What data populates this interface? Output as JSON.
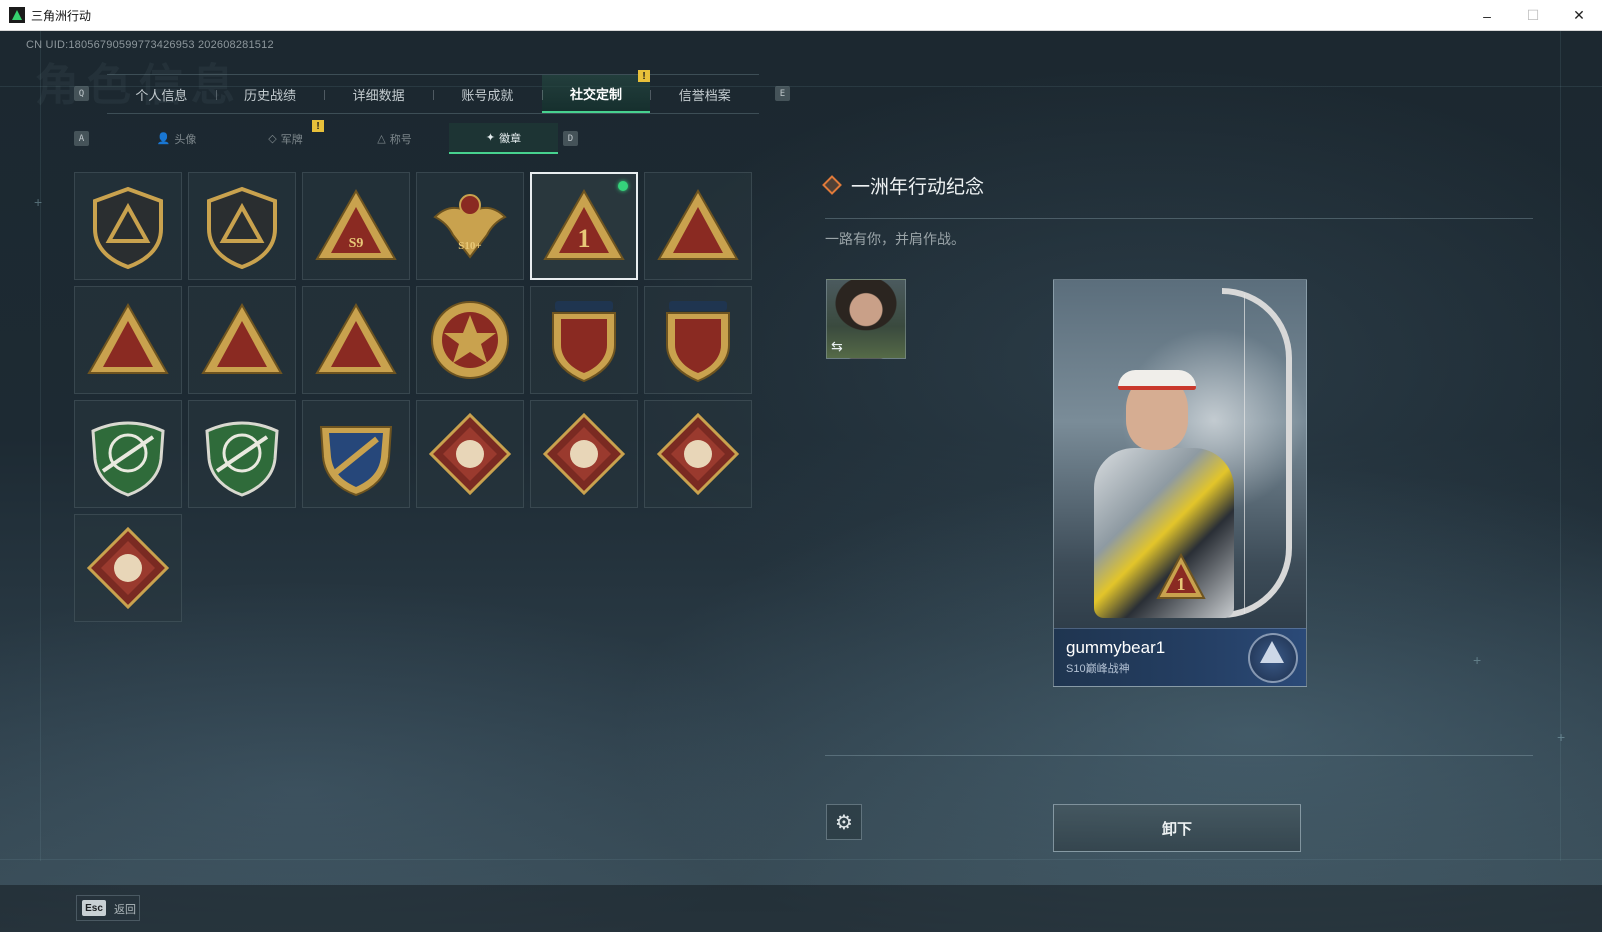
{
  "window": {
    "title": "三角洲行动",
    "controls": [
      "–",
      "☐",
      "✕"
    ]
  },
  "watermark": "角色信息",
  "uid": "CN UID:18056790599773426953 202608281512",
  "top_tabs": {
    "left_key": "Q",
    "right_key": "E",
    "items": [
      "个人信息",
      "历史战绩",
      "详细数据",
      "账号成就",
      "社交定制",
      "信誉档案"
    ],
    "active": "社交定制",
    "badge": "!"
  },
  "sub_tabs": {
    "left_key": "A",
    "right_key": "D",
    "items": [
      {
        "label": "头像",
        "icon": "person-icon"
      },
      {
        "label": "军牌",
        "icon": "dogtag-icon"
      },
      {
        "label": "称号",
        "icon": "title-icon"
      },
      {
        "label": "徽章",
        "icon": "badge-icon"
      }
    ],
    "active": "徽章",
    "badge": "!"
  },
  "medals": [
    {
      "name": "shield-delta-medal",
      "style": "shield"
    },
    {
      "name": "helicopter-medal",
      "style": "shield"
    },
    {
      "name": "s9-triangle-medal",
      "style": "triangle",
      "label": "S9"
    },
    {
      "name": "s10-eagle-medal",
      "style": "eagle",
      "label": "S10+"
    },
    {
      "name": "first-year-medal",
      "style": "triangle",
      "label": "1",
      "selected": true,
      "equipped": true
    },
    {
      "name": "hexagram-triangle-medal",
      "style": "triangle"
    },
    {
      "name": "squad-triangle-medal",
      "style": "triangle"
    },
    {
      "name": "squad-battle-triangle-medal",
      "style": "triangle"
    },
    {
      "name": "koi-triangle-medal",
      "style": "triangle"
    },
    {
      "name": "star-round-medal",
      "style": "round"
    },
    {
      "name": "three-star-shield-medal",
      "style": "crest"
    },
    {
      "name": "three-star-hexagram-medal",
      "style": "crest"
    },
    {
      "name": "green-rifle-shield-medal",
      "style": "green-shield"
    },
    {
      "name": "green-crossed-rifle-medal",
      "style": "green-shield"
    },
    {
      "name": "blue-gold-shield-medal",
      "style": "blue-shield"
    },
    {
      "name": "wolf-diamond-medal",
      "style": "diamond"
    },
    {
      "name": "tiger-diamond-medal",
      "style": "diamond"
    },
    {
      "name": "dragon-diamond-medal",
      "style": "diamond"
    },
    {
      "name": "wrench-diamond-medal",
      "style": "diamond"
    }
  ],
  "selected_medal": {
    "title": "一洲年行动纪念",
    "description": "一路有你，并肩作战。"
  },
  "player_card": {
    "name": "gummybear1",
    "title": "S10巅峰战神"
  },
  "actions": {
    "unequip_label": "卸下",
    "settings_icon": "gear-icon"
  },
  "footer": {
    "esc_key": "Esc",
    "back_label": "返回"
  },
  "colors": {
    "accent_green": "#47d28f",
    "gold": "#c9a24e",
    "gold_dark": "#6e5420",
    "red": "#8a2a22",
    "navy": "#1f3550"
  }
}
